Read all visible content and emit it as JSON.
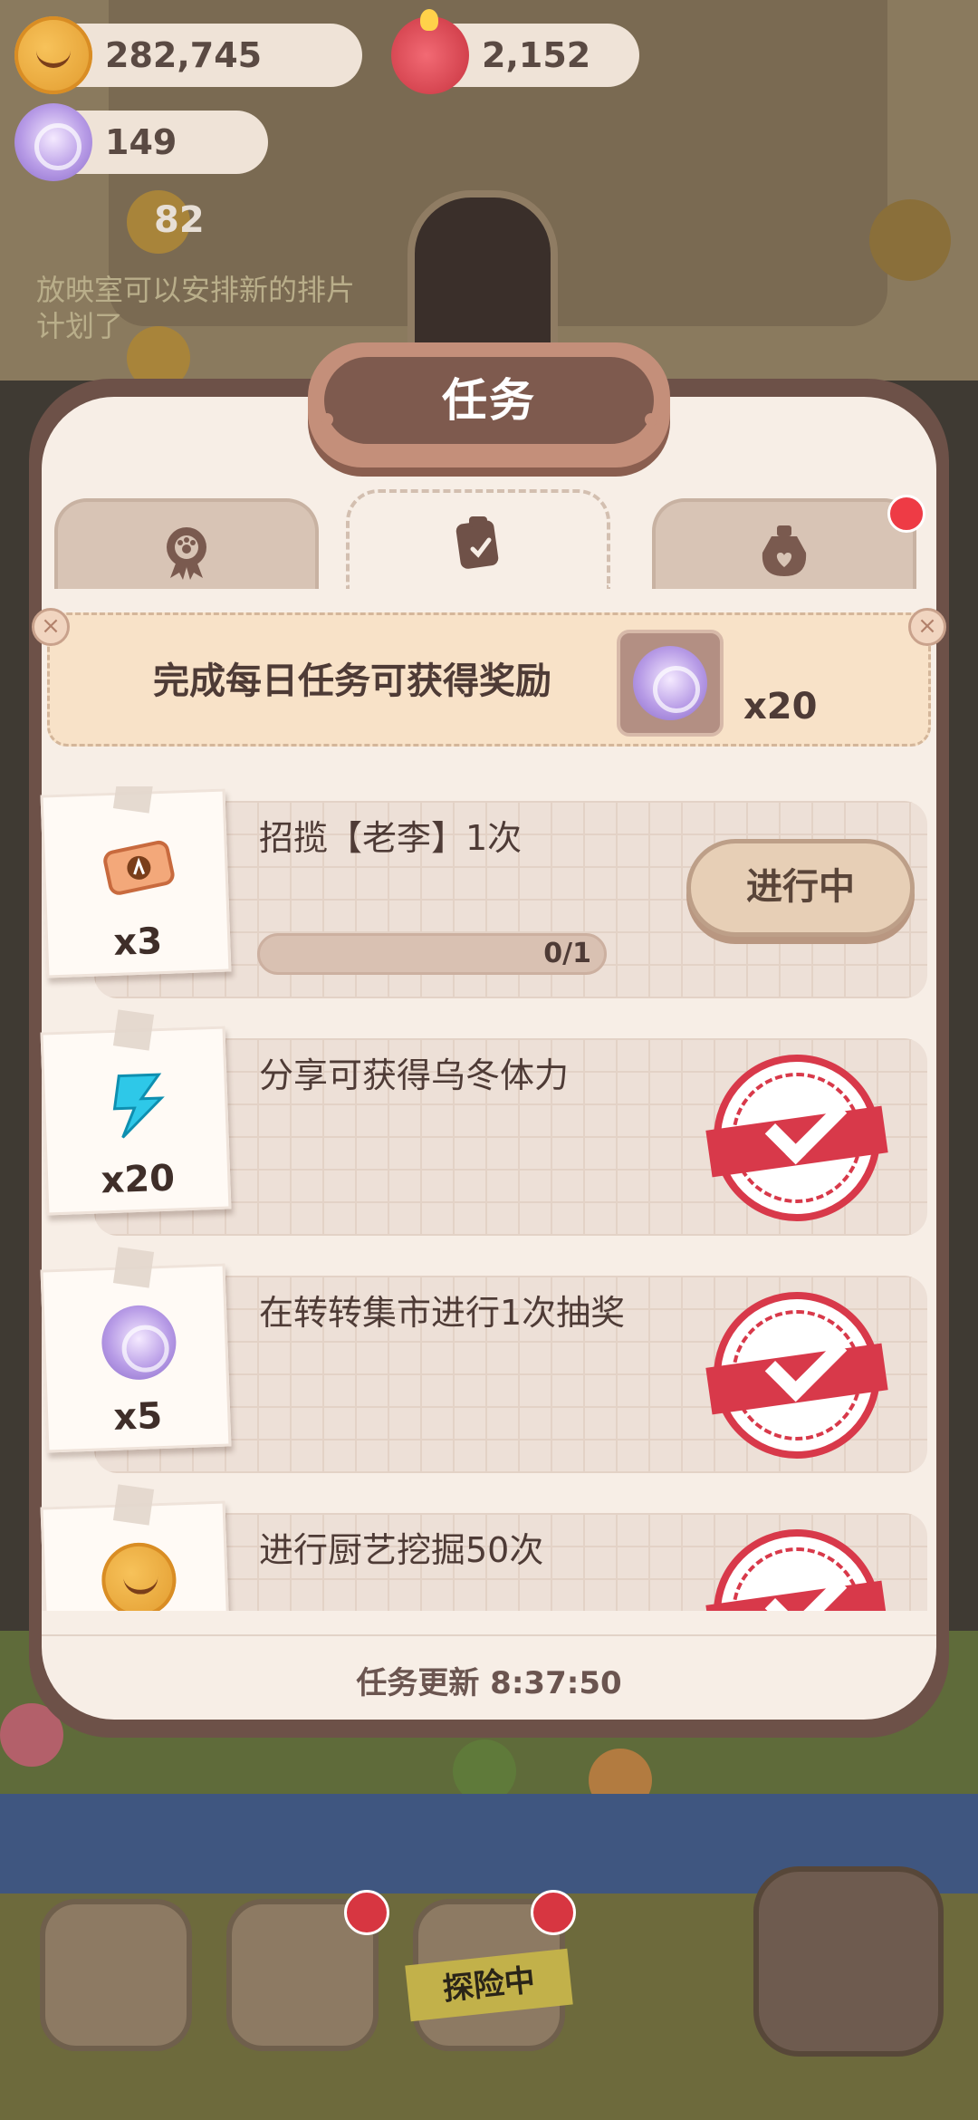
{
  "currency": {
    "cookies": "282,745",
    "candles": "2,152",
    "candy": "149"
  },
  "background": {
    "level_number": "82",
    "notice": "放映室可以安排新的排片计划了",
    "explore_label": "探险中"
  },
  "modal": {
    "title": "任务",
    "tabs": [
      {
        "icon": "badge-icon",
        "active": false
      },
      {
        "icon": "clipboard-icon",
        "active": true
      },
      {
        "icon": "gift-bag-icon",
        "active": false,
        "has_badge": true
      }
    ],
    "daily_reward": {
      "text": "完成每日任务可获得奖励",
      "reward_icon": "candy-icon",
      "reward_qty": "x20"
    },
    "tasks": [
      {
        "name": "招揽【老李】1次",
        "reward_icon": "ticket-icon",
        "reward_qty": "x3",
        "progress": "0/1",
        "progress_value": 0,
        "status": "in_progress",
        "button_label": "进行中"
      },
      {
        "name": "分享可获得乌冬体力",
        "reward_icon": "lightning-icon",
        "reward_qty": "x20",
        "status": "completed"
      },
      {
        "name": "在转转集市进行1次抽奖",
        "reward_icon": "candy-icon",
        "reward_qty": "x5",
        "status": "completed"
      },
      {
        "name": "进行厨艺挖掘50次",
        "reward_icon": "cookie-icon",
        "reward_qty": "",
        "status": "completed"
      }
    ],
    "refresh_text": "任务更新 8:37:50"
  },
  "colors": {
    "accent_red": "#d8394a",
    "panel_bg": "#f7eee6",
    "frame": "#6d5148"
  }
}
